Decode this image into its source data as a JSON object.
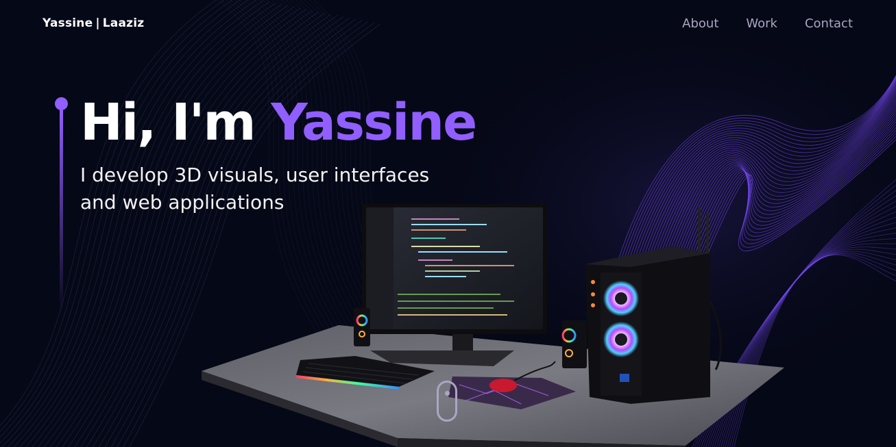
{
  "nav": {
    "logo_first": "Yassine",
    "logo_sep": "|",
    "logo_last": "Laaziz",
    "links": [
      "About",
      "Work",
      "Contact"
    ]
  },
  "hero": {
    "greeting": "Hi, I'm",
    "name": "Yassine",
    "subtitle": "I develop 3D visuals, user interfaces and web applications"
  },
  "colors": {
    "background": "#050816",
    "accent": "#915eff",
    "text": "#ffffff",
    "muted": "#aaa6c3"
  },
  "icons": {
    "scroll": "mouse-scroll-icon"
  }
}
